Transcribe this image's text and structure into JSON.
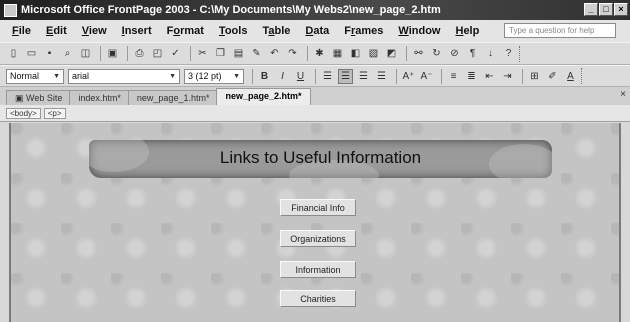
{
  "window": {
    "title": "Microsoft Office FrontPage 2003 - C:\\My Documents\\My Webs2\\new_page_2.htm",
    "buttons": [
      "_",
      "□",
      "×"
    ]
  },
  "menubar": {
    "items": [
      {
        "prefix": "",
        "key": "F",
        "rest": "ile"
      },
      {
        "prefix": "",
        "key": "E",
        "rest": "dit"
      },
      {
        "prefix": "",
        "key": "V",
        "rest": "iew"
      },
      {
        "prefix": "",
        "key": "I",
        "rest": "nsert"
      },
      {
        "prefix": "F",
        "key": "o",
        "rest": "rmat"
      },
      {
        "prefix": "",
        "key": "T",
        "rest": "ools"
      },
      {
        "prefix": "T",
        "key": "a",
        "rest": "ble"
      },
      {
        "prefix": "",
        "key": "D",
        "rest": "ata"
      },
      {
        "prefix": "F",
        "key": "r",
        "rest": "ames"
      },
      {
        "prefix": "",
        "key": "W",
        "rest": "indow"
      },
      {
        "prefix": "",
        "key": "H",
        "rest": "elp"
      }
    ],
    "help_placeholder": "Type a question for help"
  },
  "formatting": {
    "style": "Normal",
    "font": "arial",
    "size": "3 (12 pt)",
    "bold": "B",
    "italic": "I",
    "underline": "U"
  },
  "tabs": [
    {
      "label": "Web Site"
    },
    {
      "label": "index.htm*"
    },
    {
      "label": "new_page_1.htm*"
    },
    {
      "label": "new_page_2.htm*"
    }
  ],
  "tab_close": "×",
  "tags": [
    "<body>",
    "<p>"
  ],
  "page": {
    "banner_title": "Links to Useful Information",
    "links": [
      "Financial Info",
      "Organizations",
      "Information",
      "Charities"
    ]
  }
}
